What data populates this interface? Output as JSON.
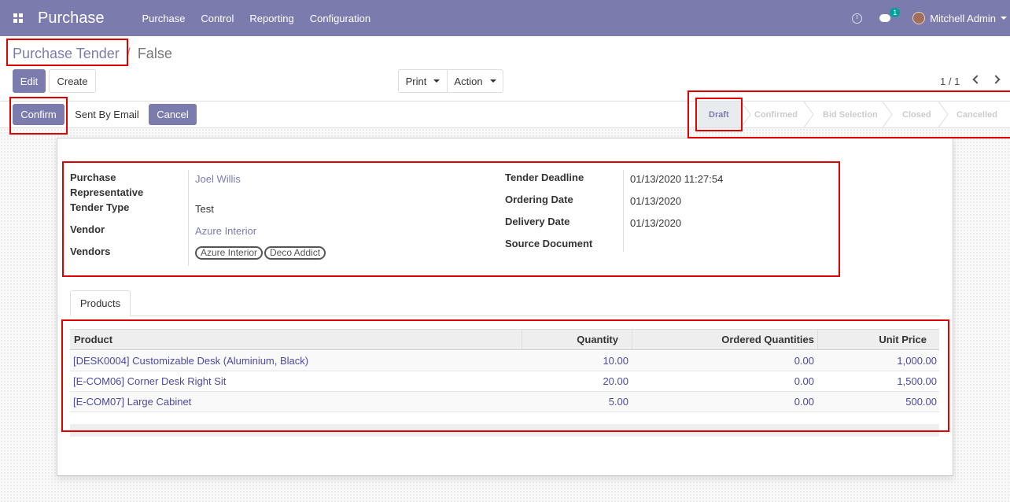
{
  "navbar": {
    "brand": "Purchase",
    "menu": [
      "Purchase",
      "Control",
      "Reporting",
      "Configuration"
    ],
    "message_count": "1",
    "user": "Mitchell Admin",
    "color": "#7c7bad"
  },
  "breadcrumb": {
    "parent": "Purchase Tender",
    "separator": "/",
    "current": "False"
  },
  "buttons": {
    "edit": "Edit",
    "create": "Create",
    "print": "Print",
    "action": "Action"
  },
  "pager": "1 / 1",
  "header_buttons": {
    "confirm": "Confirm",
    "sent_by_email": "Sent By Email",
    "cancel": "Cancel"
  },
  "stages": [
    "Draft",
    "Confirmed",
    "Bid Selection",
    "Closed",
    "Cancelled"
  ],
  "active_stage": "Draft",
  "form": {
    "purchase_representative_label_1": "Purchase",
    "purchase_representative_label_2": "Representative",
    "purchase_representative": "Joel Willis",
    "tender_type_label": "Tender Type",
    "tender_type": "Test",
    "vendor_label": "Vendor",
    "vendor": "Azure Interior",
    "vendors_label": "Vendors",
    "vendors": [
      "Azure Interior",
      "Deco Addict"
    ],
    "tender_deadline_label": "Tender Deadline",
    "tender_deadline": "01/13/2020 11:27:54",
    "ordering_date_label": "Ordering Date",
    "ordering_date": "01/13/2020",
    "delivery_date_label": "Delivery Date",
    "delivery_date": "01/13/2020",
    "source_document_label": "Source Document"
  },
  "tabs": [
    "Products"
  ],
  "table": {
    "headers": [
      "Product",
      "Quantity",
      "Ordered Quantities",
      "Unit Price"
    ],
    "rows": [
      [
        "[DESK0004] Customizable Desk (Aluminium, Black)",
        "10.00",
        "0.00",
        "1,000.00"
      ],
      [
        "[E-COM06] Corner Desk Right Sit",
        "20.00",
        "0.00",
        "1,500.00"
      ],
      [
        "[E-COM07] Large Cabinet",
        "5.00",
        "0.00",
        "500.00"
      ]
    ]
  }
}
